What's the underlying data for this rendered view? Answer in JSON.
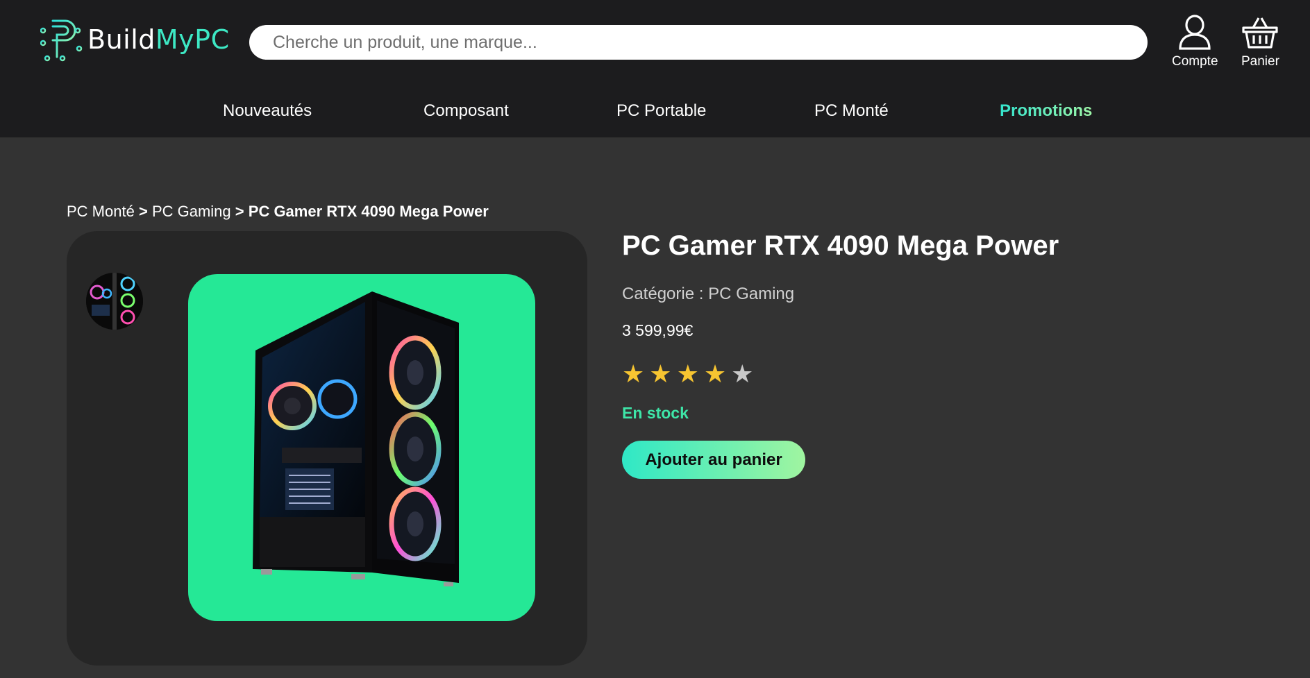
{
  "header": {
    "logo": {
      "text_part1": "Build",
      "text_part2": "MyPC",
      "icon": "circuit-p-logo-icon"
    },
    "search": {
      "placeholder": "Cherche un produit, une marque..."
    },
    "account": {
      "label": "Compte",
      "icon": "user-icon"
    },
    "cart": {
      "label": "Panier",
      "icon": "basket-icon"
    }
  },
  "nav": {
    "items": [
      {
        "label": "Nouveautés"
      },
      {
        "label": "Composant"
      },
      {
        "label": "PC Portable"
      },
      {
        "label": "PC Monté"
      },
      {
        "label": "Promotions"
      }
    ]
  },
  "breadcrumb": {
    "items": [
      "PC Monté",
      "PC Gaming",
      "PC Gamer RTX 4090 Mega Power"
    ],
    "separator": ">"
  },
  "product": {
    "title": "PC Gamer RTX 4090 Mega Power",
    "category": "Catégorie : PC Gaming",
    "price": "3 599,99€",
    "rating": 4,
    "rating_max": 5,
    "stock": "En stock",
    "add_to_cart_label": "Ajouter au panier",
    "image_icon": "gaming-pc-tower-image",
    "thumbnail_icon": "gaming-pc-thumbnail-image"
  },
  "colors": {
    "header_bg": "#1c1c1e",
    "page_bg": "#333333",
    "panel_bg": "#262626",
    "accent_teal": "#3de8c4",
    "accent_green": "#25e896",
    "stock_green": "#3ee6a8",
    "star_yellow": "#f7c531"
  }
}
